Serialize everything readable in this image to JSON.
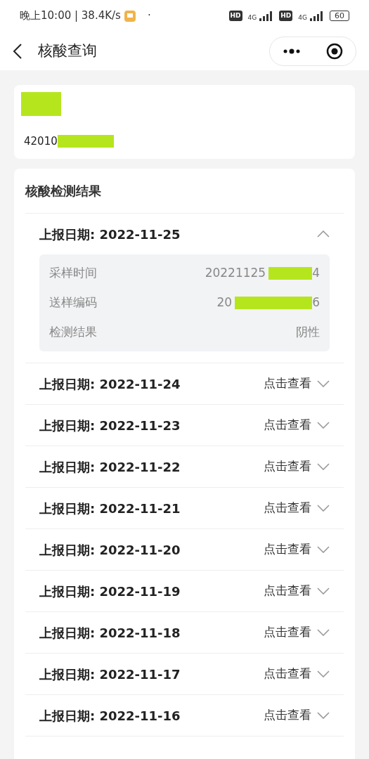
{
  "status_bar": {
    "time_speed": "晚上10:00 | 38.4K/s",
    "dot": "·",
    "sim": [
      {
        "hd": "HD",
        "network": "4G"
      },
      {
        "hd": "HD",
        "network": "4G"
      }
    ],
    "battery": "60"
  },
  "nav": {
    "title": "核酸查询"
  },
  "person": {
    "id_start": "42010"
  },
  "results": {
    "title": "核酸检测结果",
    "records": [
      {
        "date": "上报日期: 2022-11-25",
        "expanded": true,
        "details": [
          {
            "kind": "redacted",
            "label": "采样时间",
            "start": "20221125",
            "end": "4"
          },
          {
            "kind": "redacted",
            "label": "送样编码",
            "start": "20",
            "end": "6"
          },
          {
            "kind": "plain",
            "label": "检测结果",
            "value": "阴性"
          }
        ]
      },
      {
        "date": "上报日期: 2022-11-24",
        "expanded": false,
        "hint": "点击查看"
      },
      {
        "date": "上报日期: 2022-11-23",
        "expanded": false,
        "hint": "点击查看"
      },
      {
        "date": "上报日期: 2022-11-22",
        "expanded": false,
        "hint": "点击查看"
      },
      {
        "date": "上报日期: 2022-11-21",
        "expanded": false,
        "hint": "点击查看"
      },
      {
        "date": "上报日期: 2022-11-20",
        "expanded": false,
        "hint": "点击查看"
      },
      {
        "date": "上报日期: 2022-11-19",
        "expanded": false,
        "hint": "点击查看"
      },
      {
        "date": "上报日期: 2022-11-18",
        "expanded": false,
        "hint": "点击查看"
      },
      {
        "date": "上报日期: 2022-11-17",
        "expanded": false,
        "hint": "点击查看"
      },
      {
        "date": "上报日期: 2022-11-16",
        "expanded": false,
        "hint": "点击查看"
      }
    ]
  }
}
